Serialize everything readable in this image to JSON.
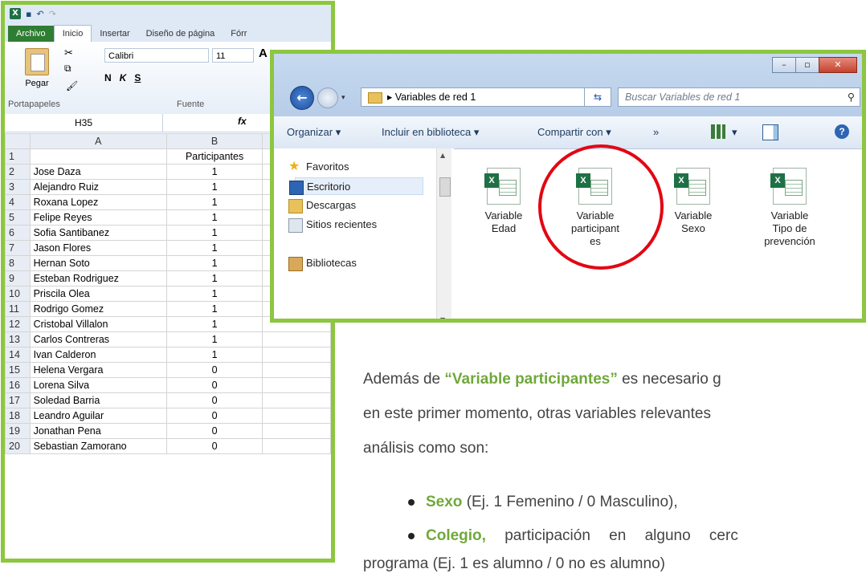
{
  "excel": {
    "ribbon_tabs": [
      "Archivo",
      "Inicio",
      "Insertar",
      "Diseño de página",
      "Fórr"
    ],
    "paste_label": "Pegar",
    "font_name": "Calibri",
    "font_size": "11",
    "bold": "N",
    "italic": "K",
    "underline": "S",
    "group_clipboard": "Portapapeles",
    "group_font": "Fuente",
    "name_box": "H35",
    "fx_label": "fx",
    "col_headers": [
      "A",
      "B"
    ],
    "header_row": {
      "num": "1",
      "a": "",
      "b": "Participantes"
    },
    "rows": [
      {
        "num": "2",
        "name": "Jose Daza",
        "val": "1"
      },
      {
        "num": "3",
        "name": "Alejandro Ruiz",
        "val": "1"
      },
      {
        "num": "4",
        "name": "Roxana Lopez",
        "val": "1"
      },
      {
        "num": "5",
        "name": "Felipe Reyes",
        "val": "1"
      },
      {
        "num": "6",
        "name": "Sofia Santibanez",
        "val": "1"
      },
      {
        "num": "7",
        "name": "Jason Flores",
        "val": "1"
      },
      {
        "num": "8",
        "name": "Hernan Soto",
        "val": "1"
      },
      {
        "num": "9",
        "name": "Esteban Rodriguez",
        "val": "1"
      },
      {
        "num": "10",
        "name": "Priscila Olea",
        "val": "1"
      },
      {
        "num": "11",
        "name": "Rodrigo Gomez",
        "val": "1"
      },
      {
        "num": "12",
        "name": "Cristobal Villalon",
        "val": "1"
      },
      {
        "num": "13",
        "name": "Carlos Contreras",
        "val": "1"
      },
      {
        "num": "14",
        "name": "Ivan Calderon",
        "val": "1"
      },
      {
        "num": "15",
        "name": "Helena Vergara",
        "val": "0"
      },
      {
        "num": "16",
        "name": "Lorena Silva",
        "val": "0"
      },
      {
        "num": "17",
        "name": "Soledad Barria",
        "val": "0"
      },
      {
        "num": "18",
        "name": "Leandro Aguilar",
        "val": "0"
      },
      {
        "num": "19",
        "name": "Jonathan Pena",
        "val": "0"
      },
      {
        "num": "20",
        "name": "Sebastian Zamorano",
        "val": "0"
      }
    ]
  },
  "explorer": {
    "address": "Variables de red 1",
    "search_placeholder": "Buscar Variables de red 1",
    "toolbar": {
      "organize": "Organizar ▾",
      "library": "Incluir en biblioteca ▾",
      "share": "Compartir con ▾",
      "more": "»"
    },
    "nav": {
      "favorites": "Favoritos",
      "desktop": "Escritorio",
      "downloads": "Descargas",
      "recent": "Sitios recientes",
      "libraries": "Bibliotecas"
    },
    "files": [
      {
        "label1": "Variable",
        "label2": "Edad",
        "label3": ""
      },
      {
        "label1": "Variable",
        "label2": "participant",
        "label3": "es"
      },
      {
        "label1": "Variable",
        "label2": "Sexo",
        "label3": ""
      },
      {
        "label1": "Variable",
        "label2": "Tipo de",
        "label3": "prevención"
      }
    ]
  },
  "text": {
    "p1_prefix": "Además de ",
    "p1_highlight": "“Variable participantes”",
    "p1_suffix": " es necesario g",
    "p2": "en este primer momento, otras variables relevantes",
    "p3": "análisis como son:",
    "b1_bold": "Sexo",
    "b1_rest": " (Ej. 1 Femenino / 0 Masculino),",
    "b2_bold": "Colegio,",
    "b2_rest": " participación en alguno cerc",
    "p4": "programa (Ej. 1 es alumno / 0 no es alumno)"
  },
  "colors": {
    "frame": "#8dc63f",
    "highlight": "#70a83a",
    "circle": "#e30613"
  }
}
